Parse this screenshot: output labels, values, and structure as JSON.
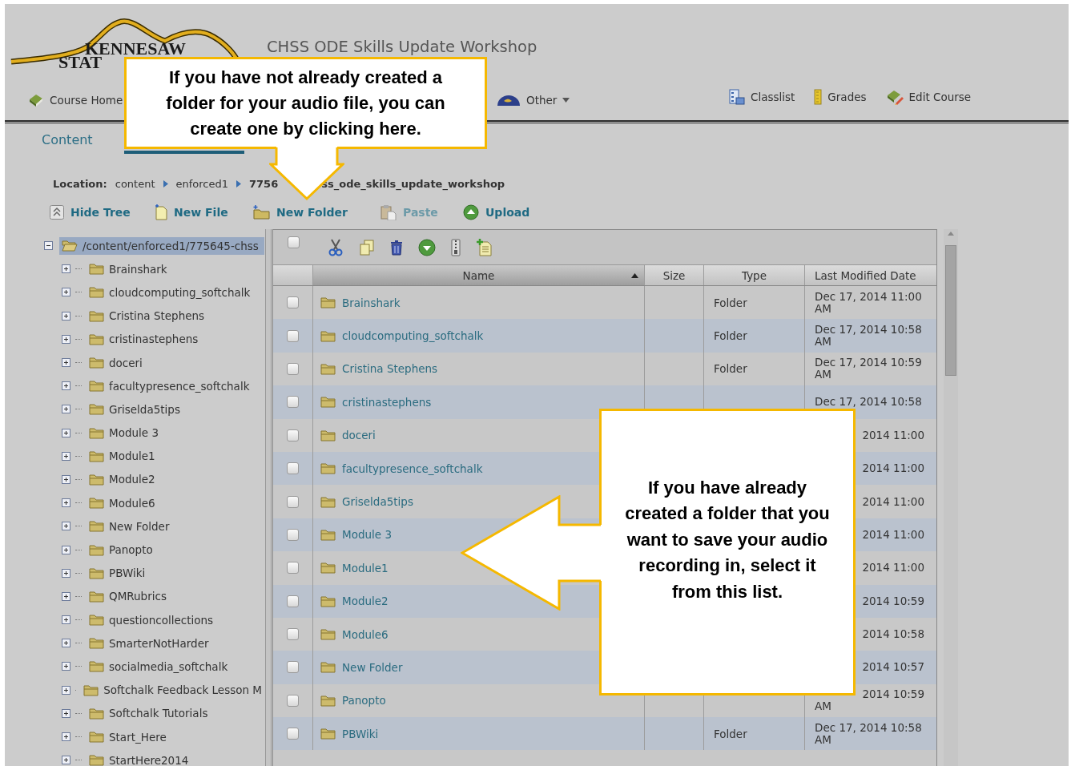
{
  "header": {
    "logo": {
      "line1": "KENNESAW",
      "line2": "STAT"
    },
    "course_title": "CHSS ODE Skills Update Workshop",
    "nav_left": [
      {
        "label": "Course Home"
      },
      {
        "label": "Other",
        "has_menu": true
      }
    ],
    "nav_right": [
      "Classlist",
      "Grades",
      "Edit Course"
    ]
  },
  "section_tab": "Content",
  "location": {
    "label": "Location:",
    "crumbs": [
      "content",
      "enforced1"
    ],
    "current": [
      "7756",
      "ss_ode_skills_update_workshop"
    ]
  },
  "toolbar": [
    {
      "label": "Hide Tree",
      "disabled": false
    },
    {
      "label": "New File",
      "disabled": false
    },
    {
      "label": "New Folder",
      "disabled": false
    },
    {
      "label": "Paste",
      "disabled": true
    },
    {
      "label": "Upload",
      "disabled": false
    }
  ],
  "tree": {
    "label": "/content/enforced1/775645-chss",
    "expanded": true,
    "selected": true,
    "children": [
      {
        "label": "Brainshark",
        "expanded": false,
        "selected": false
      },
      {
        "label": "cloudcomputing_softchalk",
        "expanded": false,
        "selected": false
      },
      {
        "label": "Cristina Stephens",
        "expanded": false,
        "selected": false
      },
      {
        "label": "cristinastephens",
        "expanded": false,
        "selected": false
      },
      {
        "label": "doceri",
        "expanded": false,
        "selected": false
      },
      {
        "label": "facultypresence_softchalk",
        "expanded": false,
        "selected": false
      },
      {
        "label": "Griselda5tips",
        "expanded": false,
        "selected": false
      },
      {
        "label": "Module 3",
        "expanded": false,
        "selected": false
      },
      {
        "label": "Module1",
        "expanded": false,
        "selected": false
      },
      {
        "label": "Module2",
        "expanded": false,
        "selected": false
      },
      {
        "label": "Module6",
        "expanded": false,
        "selected": false
      },
      {
        "label": "New Folder",
        "expanded": false,
        "selected": false
      },
      {
        "label": "Panopto",
        "expanded": false,
        "selected": false
      },
      {
        "label": "PBWiki",
        "expanded": false,
        "selected": false
      },
      {
        "label": "QMRubrics",
        "expanded": false,
        "selected": false
      },
      {
        "label": "questioncollections",
        "expanded": false,
        "selected": false
      },
      {
        "label": "SmarterNotHarder",
        "expanded": false,
        "selected": false
      },
      {
        "label": "socialmedia_softchalk",
        "expanded": false,
        "selected": false
      },
      {
        "label": "Softchalk Feedback Lesson M",
        "expanded": false,
        "selected": false
      },
      {
        "label": "Softchalk Tutorials",
        "expanded": false,
        "selected": false
      },
      {
        "label": "Start_Here",
        "expanded": false,
        "selected": false
      },
      {
        "label": "StartHere2014",
        "expanded": false,
        "selected": false
      }
    ]
  },
  "grid": {
    "select_all_checked": false,
    "columns": [
      {
        "label": "Name",
        "sorted": true
      },
      {
        "label": "Size"
      },
      {
        "label": "Type"
      },
      {
        "label": "Last Modified Date"
      }
    ],
    "rows": [
      {
        "kind": "full",
        "checked": false,
        "name": "Brainshark",
        "type": "Folder",
        "date": [
          "Dec 17, 2014 11:00",
          "AM"
        ]
      },
      {
        "kind": "full",
        "checked": false,
        "name": "cloudcomputing_softchalk",
        "type": "Folder",
        "date": [
          "Dec 17, 2014 10:58",
          "AM"
        ]
      },
      {
        "kind": "full",
        "checked": false,
        "name": "Cristina Stephens",
        "type": "Folder",
        "date": [
          "Dec 17, 2014 10:59",
          "AM"
        ]
      },
      {
        "kind": "full",
        "checked": false,
        "name": "cristinastephens",
        "date": [
          "Dec 17, 2014 10:58"
        ]
      },
      {
        "kind": "covered",
        "checked": false,
        "name": "doceri",
        "date": [
          "2014 11:00"
        ]
      },
      {
        "kind": "covered",
        "checked": false,
        "name": "facultypresence_softchalk",
        "date": [
          "2014 11:00"
        ]
      },
      {
        "kind": "covered",
        "checked": false,
        "name": "Griselda5tips",
        "date": [
          "2014 11:00"
        ]
      },
      {
        "kind": "covered",
        "checked": false,
        "name": "Module 3",
        "date": [
          "2014 11:00"
        ]
      },
      {
        "kind": "covered",
        "checked": false,
        "name": "Module1",
        "date": [
          "2014 11:00"
        ]
      },
      {
        "kind": "covered",
        "checked": false,
        "name": "Module2",
        "date": [
          "2014 10:59"
        ]
      },
      {
        "kind": "covered",
        "checked": false,
        "name": "Module6",
        "date": [
          "2014 10:58"
        ]
      },
      {
        "kind": "covered",
        "checked": false,
        "name": "New Folder",
        "date": [
          "2014 10:57"
        ]
      },
      {
        "kind": "covered",
        "checked": false,
        "name": "Panopto",
        "date": [
          "2014 10:59",
          "AM"
        ]
      },
      {
        "kind": "full",
        "checked": false,
        "name": "PBWiki",
        "type": "Folder",
        "date": [
          "Dec 17, 2014 10:58",
          "AM"
        ]
      }
    ]
  },
  "callouts": [
    {
      "kind": "down",
      "text": "If you have not already created a folder for your audio file, you can create one by clicking here."
    },
    {
      "kind": "left",
      "text": "If you have already created a folder that you want to save your audio recording in, select it from this list."
    }
  ]
}
